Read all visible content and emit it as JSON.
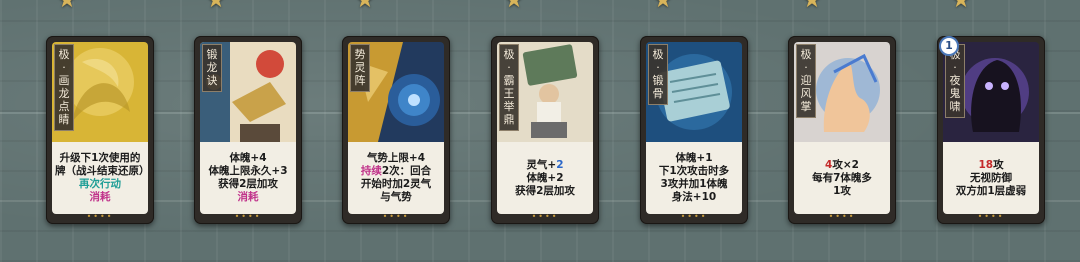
{
  "cards": [
    {
      "name": [
        "极",
        "·",
        "画",
        "龙",
        "点",
        "睛"
      ],
      "lines": [
        {
          "text": "升级下1次使用的牌（战斗结束还原）",
          "wrap": true
        },
        {
          "text": "再次行动",
          "color": "teal"
        },
        {
          "text": "消耗",
          "color": "mag"
        }
      ]
    },
    {
      "name": [
        "锻",
        "龙",
        "诀"
      ],
      "lines": [
        {
          "text": "体魄+4"
        },
        {
          "text": "体魄上限永久+3"
        },
        {
          "text": "获得2层加攻"
        },
        {
          "text": "消耗",
          "color": "mag"
        }
      ]
    },
    {
      "name": [
        "势",
        "灵",
        "阵"
      ],
      "lines": [
        {
          "text": "气势上限+4"
        },
        {
          "prefix": "持续",
          "prefix_color": "mag",
          "text": "2次：回合"
        },
        {
          "text": "开始时加2灵气"
        },
        {
          "text": "与气势"
        }
      ]
    },
    {
      "name": [
        "极",
        "·",
        "霸",
        "王",
        "举",
        "鼎"
      ],
      "lines": [
        {
          "text": "灵气+",
          "suffix": "2",
          "suffix_color": "blue"
        },
        {
          "text": "体魄+2"
        },
        {
          "text": "获得2层加攻"
        }
      ]
    },
    {
      "name": [
        "极",
        "·",
        "锻",
        "骨"
      ],
      "lines": [
        {
          "text": "体魄+1"
        },
        {
          "text": "下1次攻击时多"
        },
        {
          "text": "3攻并加1体魄"
        },
        {
          "text": "身法+10"
        }
      ]
    },
    {
      "name": [
        "极",
        "·",
        "迎",
        "风",
        "掌"
      ],
      "lines": [
        {
          "prefix": "4",
          "prefix_color": "red",
          "text": "攻×2"
        },
        {
          "text": "每有7体魄多"
        },
        {
          "text": "1攻"
        }
      ]
    },
    {
      "name": [
        "极",
        "·",
        "夜",
        "鬼",
        "啸"
      ],
      "badge": "1",
      "lines": [
        {
          "prefix": "18",
          "prefix_color": "red",
          "text": "攻"
        },
        {
          "text": "无视防御"
        },
        {
          "text": "双方加1层虚弱"
        }
      ]
    }
  ],
  "colors": {
    "accent_gold": "#c79a3c",
    "teal": "#1e9e96",
    "magenta": "#c0328a",
    "red": "#c42a2a",
    "blue": "#2b67c9"
  },
  "icons": [
    "star-icon",
    "card-art-dragon",
    "card-art-forge",
    "card-art-formation",
    "card-art-cauldron",
    "card-art-scroll",
    "card-art-palm",
    "card-art-ghost"
  ]
}
